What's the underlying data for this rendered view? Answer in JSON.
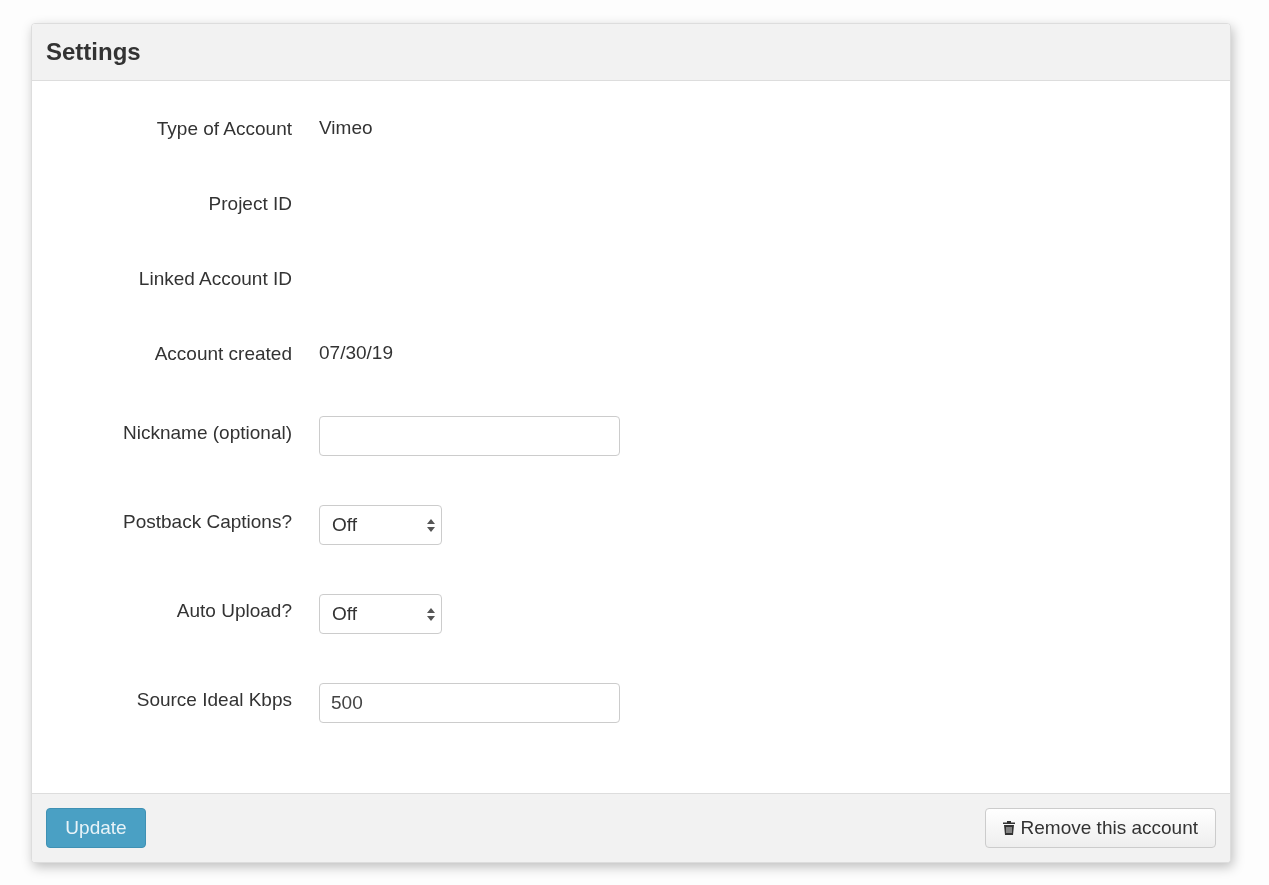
{
  "panel": {
    "title": "Settings"
  },
  "fields": [
    {
      "kind": "static",
      "label": "Type of Account",
      "value": "Vimeo"
    },
    {
      "kind": "static",
      "label": "Project ID"
    },
    {
      "kind": "static",
      "label": "Linked Account ID"
    },
    {
      "kind": "static",
      "label": "Account created",
      "value": "07/30/19"
    },
    {
      "kind": "input",
      "label": "Nickname (optional)"
    },
    {
      "kind": "select",
      "label": "Postback Captions?",
      "value": "Off"
    },
    {
      "kind": "select",
      "label": "Auto Upload?",
      "value": "Off"
    },
    {
      "kind": "input",
      "label": "Source Ideal Kbps",
      "value": "500"
    }
  ],
  "footer": {
    "update_button": "Update",
    "remove_button": "Remove this account"
  }
}
